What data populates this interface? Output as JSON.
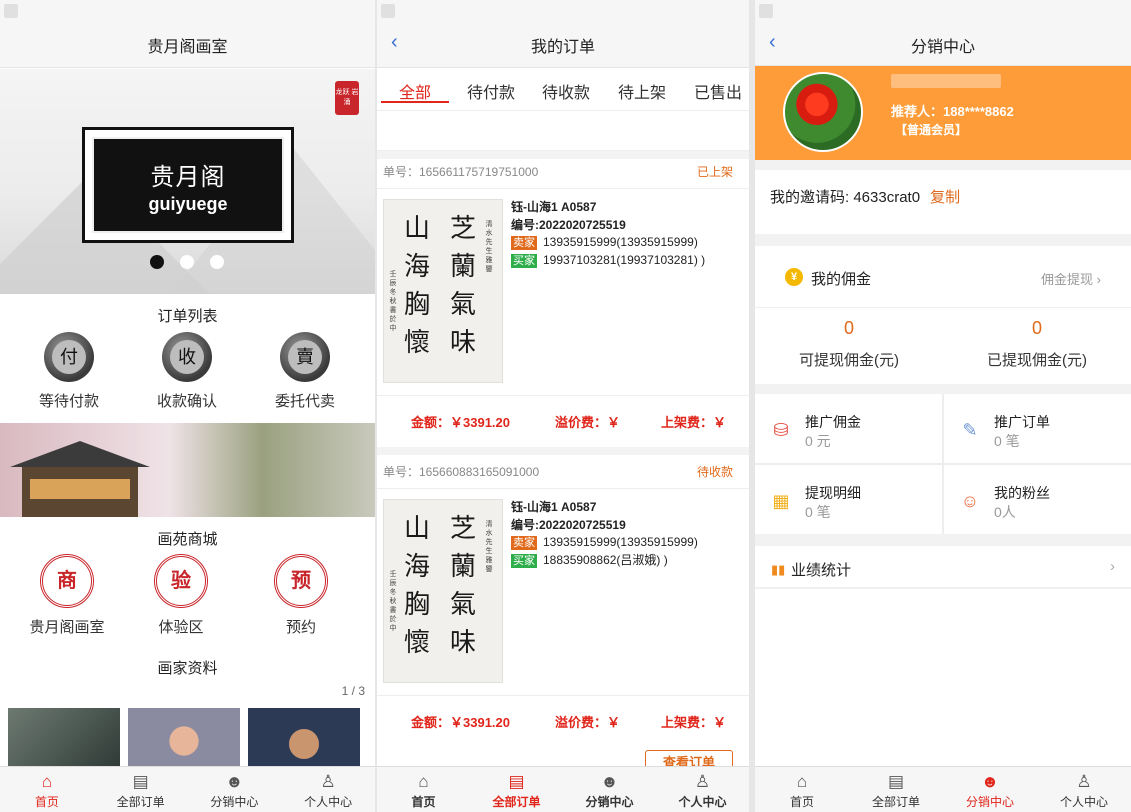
{
  "home": {
    "title": "贵月阁画室",
    "banner": {
      "seal": "龙跃 岩涌",
      "name_cn": "贵月阁",
      "name_en": "guiyuege"
    },
    "orders_section": "订单列表",
    "order_icons": [
      {
        "glyph": "付",
        "label": "等待付款",
        "icon": "pay-pending-icon"
      },
      {
        "glyph": "收",
        "label": "收款确认",
        "icon": "payment-confirm-icon"
      },
      {
        "glyph": "賣",
        "label": "委托代卖",
        "icon": "consignment-icon"
      }
    ],
    "mall_section": "画苑商城",
    "mall_icons": [
      {
        "glyph": "商",
        "label": "贵月阁画室",
        "icon": "shop-seal-icon"
      },
      {
        "glyph": "验",
        "label": "体验区",
        "icon": "experience-seal-icon"
      },
      {
        "glyph": "预",
        "label": "预约",
        "icon": "reserve-seal-icon"
      }
    ],
    "artists_section": "画家资料",
    "pager": "1 / 3"
  },
  "orders": {
    "title": "我的订单",
    "tabs": [
      "全部",
      "待付款",
      "待收款",
      "待上架",
      "已售出"
    ],
    "active_tab": 0,
    "calligraphy": {
      "col1": "芝蘭氣味",
      "col2": "山海胸懷",
      "small1": "清水先生雅鑒",
      "small2": "壬辰冬秋書於中"
    },
    "items": [
      {
        "order_no": "单号：165661175719751000",
        "status": "已上架",
        "name": "钰-山海1 A0587",
        "code": "编号:2022020725519",
        "seller": "13935915999(13935915999)",
        "buyer": "19937103281(19937103281) )",
        "amount": "金额：￥3391.20",
        "premium": "溢价费：￥",
        "listing_fee": "上架费：￥"
      },
      {
        "order_no": "单号：165660883165091000",
        "status": "待收款",
        "name": "钰-山海1 A0587",
        "code": "编号:2022020725519",
        "seller": "13935915999(13935915999)",
        "buyer": "18835908862(吕淑娥) )",
        "amount": "金额：￥3391.20",
        "premium": "溢价费：￥",
        "listing_fee": "上架费：￥"
      }
    ],
    "seller_tag": "卖家",
    "buyer_tag": "买家",
    "view_button": "查看订单"
  },
  "distribution": {
    "title": "分销中心",
    "referrer": "推荐人：188****8862",
    "level": "【普通会员】",
    "invite_label": "我的邀请码: 4633crat0",
    "copy": "复制",
    "commission_title": "我的佣金",
    "withdraw": "佣金提现",
    "available_value": "0",
    "available_label": "可提现佣金(元)",
    "withdrawn_value": "0",
    "withdrawn_label": "已提现佣金(元)",
    "grid": [
      {
        "title": "推广佣金",
        "value": "0 元",
        "icon": "coins-icon"
      },
      {
        "title": "推广订单",
        "value": "0 笔",
        "icon": "order-edit-icon"
      },
      {
        "title": "提现明细",
        "value": "0 笔",
        "icon": "calendar-icon"
      },
      {
        "title": "我的粉丝",
        "value": "0人",
        "icon": "fans-icon"
      }
    ],
    "performance": "业绩统计"
  },
  "tabbar": [
    "首页",
    "全部订单",
    "分销中心",
    "个人中心"
  ],
  "colors": {
    "accent": "#e0251b",
    "orange": "#fd9c38",
    "status": "#e06a1b"
  }
}
